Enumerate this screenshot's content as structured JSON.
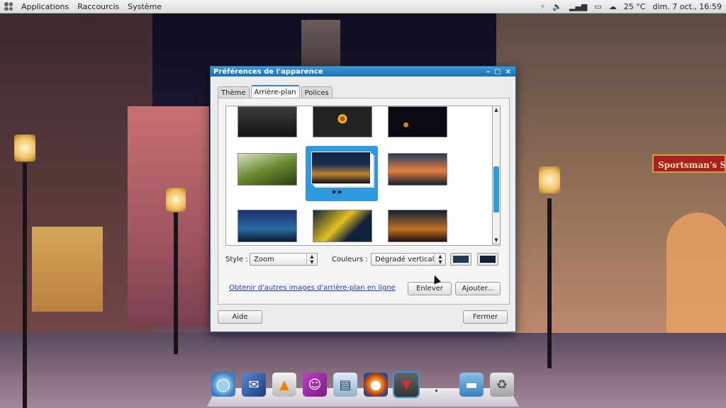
{
  "top_panel": {
    "menus": [
      "Applications",
      "Raccourcis",
      "Système"
    ],
    "tray": {
      "temperature": "25 °C",
      "datetime": "dim. 7 oct., 16:59"
    }
  },
  "window": {
    "title": "Préférences de l'apparence",
    "controls": [
      "–",
      "□",
      "×"
    ],
    "tabs": [
      {
        "label": "Thème",
        "active": false
      },
      {
        "label": "Arrière-plan",
        "active": true
      },
      {
        "label": "Polices",
        "active": false
      }
    ],
    "style_label": "Style :",
    "style_value": "Zoom",
    "colors_label": "Couleurs :",
    "colors_value": "Dégradé vertical",
    "color1": "#1e3a56",
    "color2": "#0f2438",
    "online_link": "Obtenir d'autres images d'arrière-plan en ligne",
    "remove_button": "Enlever",
    "add_button": "Ajouter...",
    "help_button": "Aide",
    "close_button": "Fermer",
    "selected_marker": "▶▶"
  },
  "colors": {
    "accent": "#2e9ae0",
    "titlebar": "#1c6fb0"
  },
  "scene": {
    "shop_sign": "Sportsman's Sh"
  },
  "dock": {
    "apps": [
      "chromium-icon",
      "mail-icon",
      "vlc-icon",
      "chat-icon",
      "document-icon",
      "firefox-icon",
      "suit-icon",
      "folder-icon",
      "trash-icon"
    ]
  }
}
